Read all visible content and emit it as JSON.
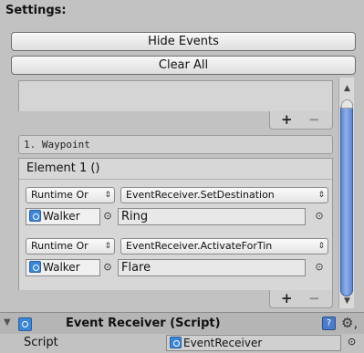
{
  "settings": {
    "title": "Settings:"
  },
  "buttons": {
    "hide_events": "Hide Events",
    "clear_all": "Clear All"
  },
  "list_controls": {
    "plus": "+",
    "minus": "−"
  },
  "waypoint": {
    "label": "1. Waypoint"
  },
  "element": {
    "title": "Element 1 ()",
    "events": [
      {
        "mode": "Runtime Or",
        "function": "EventReceiver.SetDestination",
        "object": "Walker",
        "argument": "Ring"
      },
      {
        "mode": "Runtime Or",
        "function": "EventReceiver.ActivateForTin",
        "object": "Walker",
        "argument": "Flare"
      }
    ]
  },
  "glyphs": {
    "updown": "⇕",
    "target": "⊙",
    "circle": "○",
    "up": "▲",
    "down": "▼",
    "fold": "▼",
    "gear": "⚙,",
    "help": "?"
  },
  "component": {
    "title": "Event Receiver (Script)"
  },
  "script_row": {
    "label": "Script",
    "value": "EventReceiver"
  },
  "colors": {
    "accent": "#3b86d6",
    "background": "#c2c2c2"
  }
}
